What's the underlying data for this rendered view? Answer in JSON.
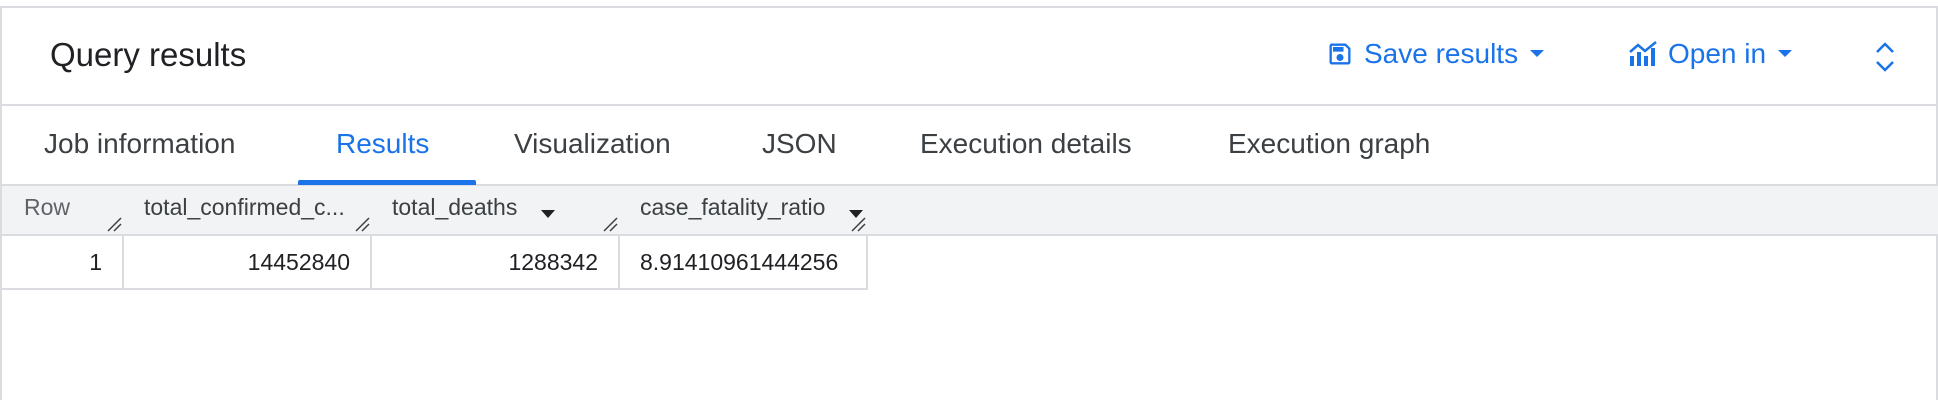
{
  "header": {
    "title": "Query results",
    "save_label": "Save results",
    "open_label": "Open in"
  },
  "tabs": [
    {
      "label": "Job information"
    },
    {
      "label": "Results",
      "active": true
    },
    {
      "label": "Visualization"
    },
    {
      "label": "JSON"
    },
    {
      "label": "Execution details"
    },
    {
      "label": "Execution graph"
    }
  ],
  "table": {
    "columns": [
      "Row",
      "total_confirmed_c...",
      "total_deaths",
      "case_fatality_ratio"
    ],
    "rows": [
      [
        "1",
        "14452840",
        "1288342",
        "8.91410961444256"
      ]
    ]
  },
  "colors": {
    "accent": "#1a73e8",
    "header_bg": "#f1f3f4",
    "border": "#dadce0"
  }
}
